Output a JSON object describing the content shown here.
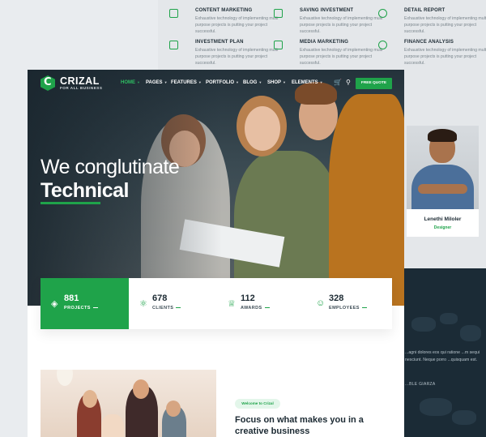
{
  "services": [
    {
      "title": "CONTENT MARKETING",
      "desc": "Exhaustive technology of implementing multi purpose projects is putting your project successful.",
      "icon": "pencil-ruler-icon"
    },
    {
      "title": "SAVING INVESTMENT",
      "desc": "Exhaustive technology of implementing multi purpose projects is putting your project successful.",
      "icon": "stack-icon"
    },
    {
      "title": "DETAIL REPORT",
      "desc": "Exhaustive technology of implementing multi purpose projects is putting your project successful.",
      "icon": "gear-icon"
    },
    {
      "title": "INVESTMENT PLAN",
      "desc": "Exhaustive technology of implementing multi purpose projects is putting your project successful.",
      "icon": "document-icon"
    },
    {
      "title": "MEDIA MARKETING",
      "desc": "Exhaustive technology of implementing multi purpose projects is putting your project successful.",
      "icon": "monitor-icon"
    },
    {
      "title": "FINANCE ANALYSIS",
      "desc": "Exhaustive technology of implementing multi purpose projects is putting your project successful.",
      "icon": "chart-gear-icon"
    }
  ],
  "team": {
    "name": "Lenethi Miloler",
    "role": "Designer"
  },
  "testimonial": {
    "text": "...agni dolores eos qui ratione ...m sequi nesciunt. Neque porro ...quisquam est.",
    "author": "...BLE GIARZA"
  },
  "site": {
    "logo": {
      "name": "CRIZAL",
      "tagline": "FOR ALL BUSINESS",
      "mark": "C"
    },
    "nav": [
      {
        "label": "HOME",
        "active": true
      },
      {
        "label": "PAGES"
      },
      {
        "label": "FEATURES"
      },
      {
        "label": "PORTFOLIO"
      },
      {
        "label": "BLOG"
      },
      {
        "label": "SHOP"
      },
      {
        "label": "ELEMENTS"
      }
    ],
    "cta": "FREE QUOTE",
    "hero": {
      "line1": "We conglutinate",
      "line2": "Technical"
    },
    "stats": [
      {
        "value": "881",
        "label": "PROJECTS",
        "icon": "layers-icon"
      },
      {
        "value": "678",
        "label": "CLIENTS",
        "icon": "atom-icon"
      },
      {
        "value": "112",
        "label": "AWARDS",
        "icon": "trophy-icon"
      },
      {
        "value": "328",
        "label": "EMPLOYEES",
        "icon": "user-icon"
      }
    ],
    "badge": "Welcome to Crizal",
    "focus_title": "Focus on what makes you in a creative business"
  },
  "colors": {
    "accent": "#1fa34a",
    "dark": "#1b2b36"
  }
}
